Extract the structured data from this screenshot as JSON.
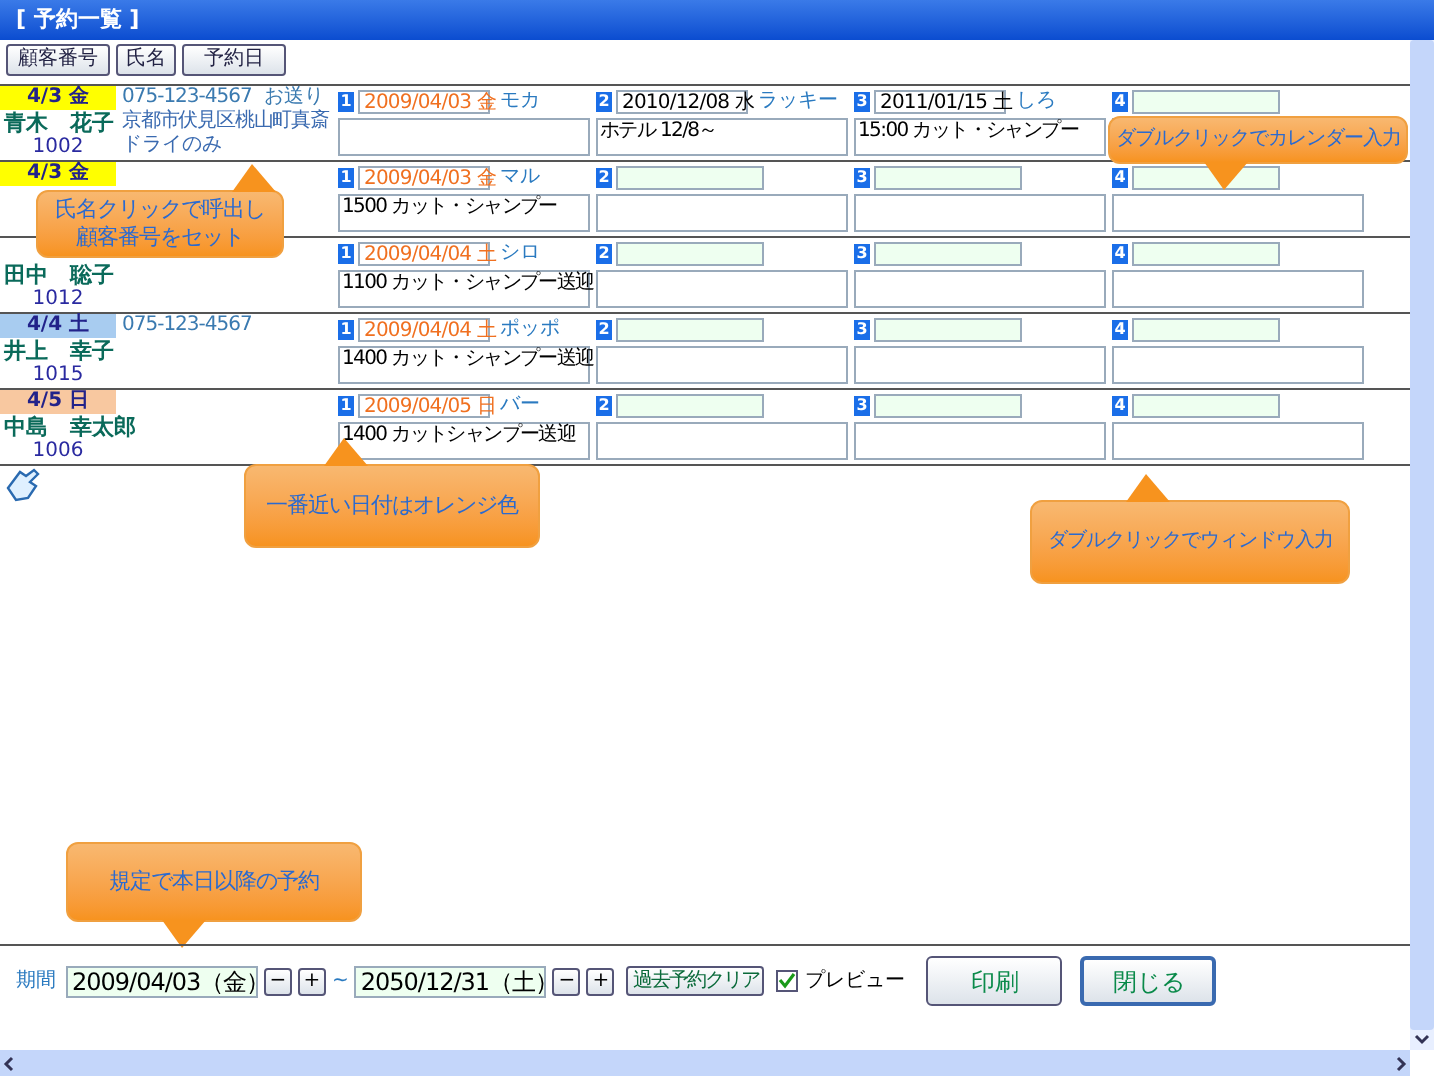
{
  "window": {
    "title": "[ 予約一覧 ]"
  },
  "sort_buttons": [
    "顧客番号",
    "氏名",
    "予約日"
  ],
  "rows": [
    {
      "date": "4/3 金",
      "color": "#ffff00",
      "name": "青木　花子",
      "number": "1002",
      "phone": "075-123-4567",
      "note": "お送り",
      "address": "京都市伏見区桃山町真斎",
      "remark": "ドライのみ",
      "slots": [
        {
          "number": "1",
          "date": "2009/04/03 金",
          "nearest": true,
          "pet": "モカ"
        },
        {
          "number": "2",
          "date": "2010/12/08 水",
          "nearest": false,
          "pet": "ラッキー",
          "memo": "ホテル 12/8～"
        },
        {
          "number": "3",
          "date": "2011/01/15 土",
          "nearest": false,
          "pet": "しろ",
          "memo": "15:00 カット・シャンプー"
        },
        {
          "number": "4"
        }
      ]
    },
    {
      "date": "4/3 金",
      "color": "#ffff00",
      "slots": [
        {
          "number": "1",
          "date": "2009/04/03 金",
          "nearest": true,
          "pet": "マル",
          "memo": "1500 カット・シャンプー"
        },
        {
          "number": "2"
        },
        {
          "number": "3"
        },
        {
          "number": "4"
        }
      ]
    },
    {
      "name": "田中　聡子",
      "number": "1012",
      "slots": [
        {
          "number": "1",
          "date": "2009/04/04 土",
          "nearest": true,
          "pet": "シロ",
          "memo": "1100 カット・シャンプー送迎"
        },
        {
          "number": "2"
        },
        {
          "number": "3"
        },
        {
          "number": "4"
        }
      ]
    },
    {
      "date": "4/4 土",
      "color": "#a8ccf0",
      "name": "井上　幸子",
      "number": "1015",
      "phone": "075-123-4567",
      "slots": [
        {
          "number": "1",
          "date": "2009/04/04 土",
          "nearest": true,
          "pet": "ポッポ",
          "memo": "1400 カット・シャンプー送迎"
        },
        {
          "number": "2"
        },
        {
          "number": "3"
        },
        {
          "number": "4"
        }
      ]
    },
    {
      "date": "4/5 日",
      "color": "#f8c8a0",
      "name": "中島　幸太郎",
      "number": "1006",
      "slots": [
        {
          "number": "1",
          "date": "2009/04/05 日",
          "nearest": true,
          "pet": "バー",
          "memo": "1400 カットシャンプー送迎"
        },
        {
          "number": "2"
        },
        {
          "number": "3"
        },
        {
          "number": "4"
        }
      ]
    }
  ],
  "callouts": [
    {
      "text": "氏名クリックで呼出し顧客番号をセット",
      "kind": "up"
    },
    {
      "text": "一番近い日付はオレンジ色",
      "kind": "up"
    },
    {
      "text": "ダブルクリックでカレンダー入力",
      "kind": "down"
    },
    {
      "text": "ダブルクリックでウィンドウ入力",
      "kind": "up"
    },
    {
      "text": "規定で本日以降の予約",
      "kind": "down"
    }
  ],
  "footer": {
    "period_label": "期間",
    "from": "2009/04/03（金）",
    "minus": "−",
    "plus": "+",
    "tilde": "~",
    "to": "2050/12/31（土）",
    "clear_button": "過去予約クリア",
    "preview": {
      "label": "プレビュー",
      "checked": true
    },
    "print_button": "印刷",
    "close_button": "閉じる"
  }
}
